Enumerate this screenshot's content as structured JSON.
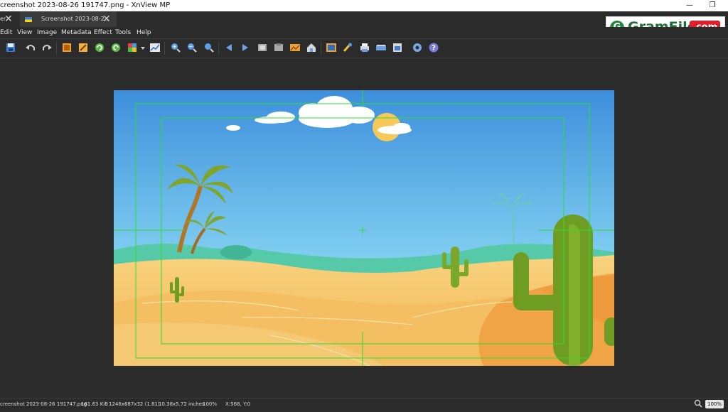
{
  "window": {
    "title": "creenshot 2023-08-26 191747.png - XnView MP",
    "minimize_glyph": "—",
    "restore_glyph": "❐"
  },
  "tabs": [
    {
      "label": "er",
      "close_glyph": "✕"
    },
    {
      "label": "Screenshot 2023-08-2...",
      "close_glyph": "✕"
    }
  ],
  "menu": [
    "Edit",
    "View",
    "Image",
    "Metadata",
    "Effect",
    "Tools",
    "Help"
  ],
  "toolbar": {
    "icons": [
      "save-icon",
      "undo-icon",
      "redo-icon",
      "crop-icon",
      "resize-icon",
      "rotate-left-icon",
      "rotate-right-icon",
      "adjust-icon",
      "dropdown-arrow-icon",
      "levels-icon",
      "zoom-in-icon",
      "zoom-out-icon",
      "zoom-fit-icon",
      "previous-icon",
      "next-icon",
      "copy-icon",
      "paste-icon",
      "slideshow-icon",
      "home-icon",
      "fullscreen-icon",
      "paint-icon",
      "print-icon",
      "scanner-icon",
      "export-icon",
      "settings-icon",
      "help-icon"
    ]
  },
  "watermark": {
    "letter": "G",
    "name": "GramFile",
    "suffix": ".com"
  },
  "image": {
    "description_colors": {
      "sky_top": "#3f93de",
      "sky_bottom": "#9ee3ef",
      "sand": "#f5c46d",
      "cactus": "#7cab2a",
      "guides": "#2dde2d"
    }
  },
  "status": {
    "filename": "creenshot 2023-08-26 191747.png",
    "filesize": "161.63 KiB",
    "dimensions": "1246x687x32 (1.81)",
    "print_size": "10.38x5.72 inches",
    "zoom_percent": "100%",
    "cursor": "X:568, Y:0",
    "zoom_badge": "100%"
  }
}
